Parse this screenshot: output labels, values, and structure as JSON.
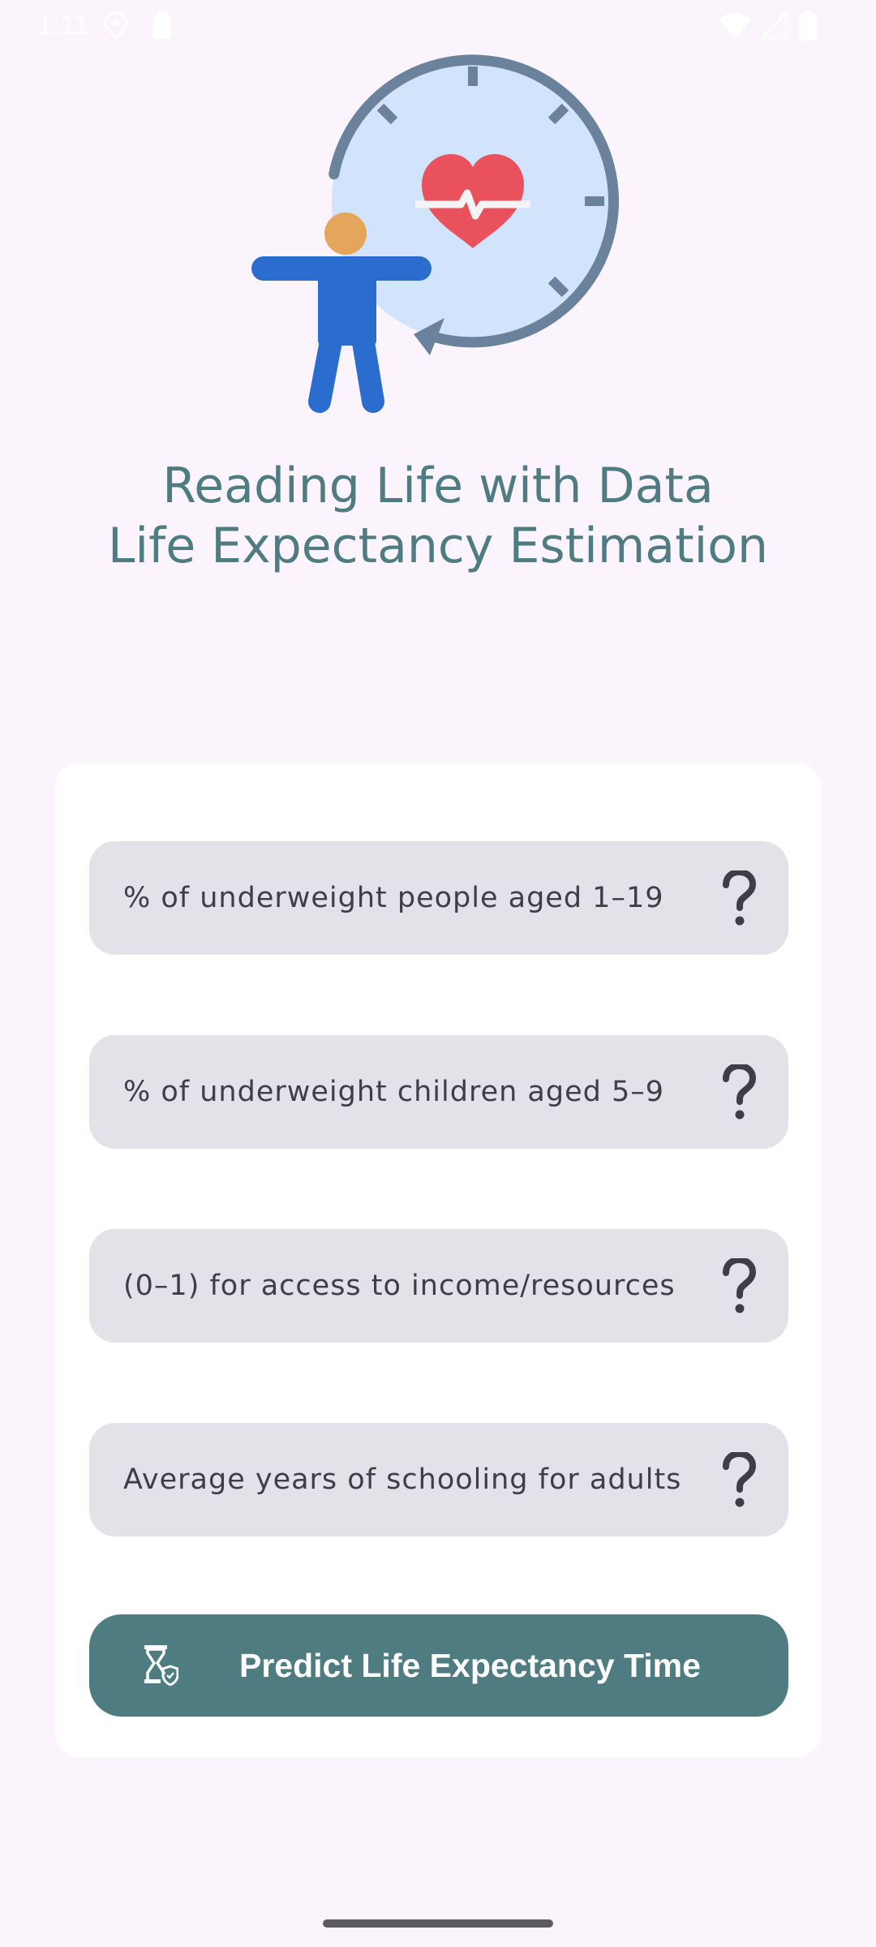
{
  "status_bar": {
    "time": "1:11",
    "icons": [
      "location-icon",
      "battery-saver-icon",
      "wifi-icon",
      "signal-icon",
      "battery-icon"
    ]
  },
  "hero": {
    "icon": "life-expectancy-illustration"
  },
  "title": {
    "line1": "Reading Life with Data",
    "line2": "Life Expectancy Estimation"
  },
  "fields": [
    {
      "placeholder": "% of underweight people aged 1–19",
      "help_icon": "help-icon"
    },
    {
      "placeholder": "% of underweight children aged 5–9",
      "help_icon": "help-icon"
    },
    {
      "placeholder": "(0–1) for access to income/resources",
      "help_icon": "help-icon"
    },
    {
      "placeholder": "Average years of schooling for adults",
      "help_icon": "help-icon"
    }
  ],
  "predict_button": {
    "label": "Predict Life Expectancy Time",
    "icon": "hourglass-shield-icon"
  },
  "colors": {
    "background": "#fcf4fc",
    "accent": "#4e7c80",
    "field_background": "#e3e2e8",
    "card_background": "#ffffff"
  }
}
